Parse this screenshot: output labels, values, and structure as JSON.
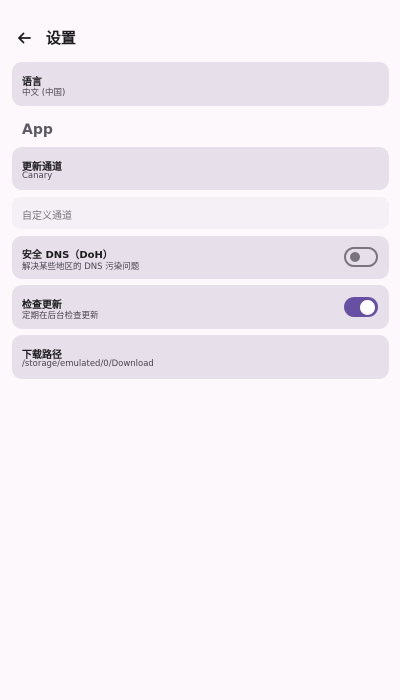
{
  "header": {
    "title": "设置",
    "back_icon": "arrow-left-icon"
  },
  "language": {
    "title": "语言",
    "value": "中文 (中国)"
  },
  "section_app": "App",
  "update_channel": {
    "title": "更新通道",
    "value": "Canary"
  },
  "custom_channel": {
    "placeholder": "自定义通道"
  },
  "secure_dns": {
    "title": "安全 DNS（DoH）",
    "subtitle": "解决某些地区的 DNS 污染问题",
    "enabled": false
  },
  "check_updates": {
    "title": "检查更新",
    "subtitle": "定期在后台检查更新",
    "enabled": true
  },
  "download_path": {
    "title": "下载路径",
    "value": "/storage/emulated/0/Download"
  },
  "colors": {
    "background": "#fdf8fc",
    "card": "#e7e0ea",
    "accent": "#6750a4"
  }
}
